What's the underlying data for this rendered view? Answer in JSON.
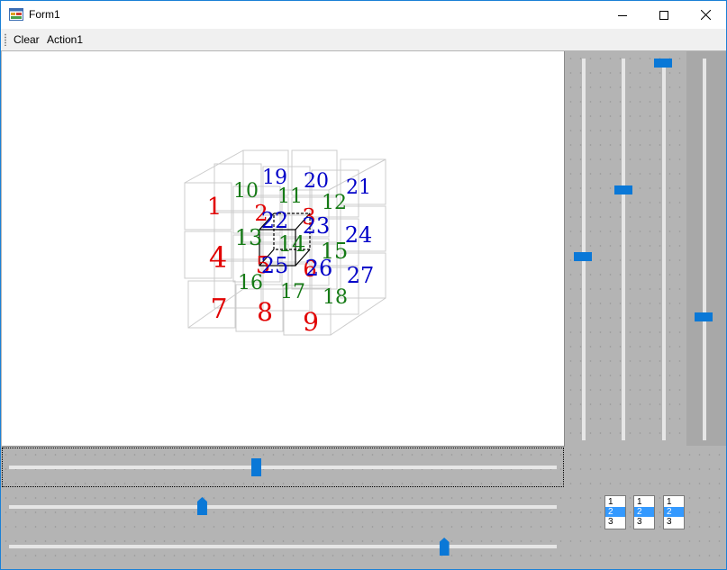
{
  "window": {
    "title": "Form1",
    "icons": {
      "app": "winforms-app-icon",
      "minimize": "minimize-icon",
      "maximize": "maximize-icon",
      "close": "close-icon"
    }
  },
  "menu": {
    "items": [
      {
        "label": "Clear"
      },
      {
        "label": "Action1"
      }
    ]
  },
  "cube": {
    "labels": [
      "1",
      "2",
      "3",
      "4",
      "5",
      "6",
      "7",
      "8",
      "9",
      "10",
      "11",
      "12",
      "13",
      "14",
      "15",
      "16",
      "17",
      "18",
      "19",
      "20",
      "21",
      "22",
      "23",
      "24",
      "25",
      "26",
      "27"
    ],
    "colors": {
      "front": "#e10000",
      "middle": "#157a15",
      "back": "#0000c8",
      "wire": "#c8c8c8",
      "selected": "#000000"
    }
  },
  "sliders": {
    "right": [
      {
        "name": "right-slider-1",
        "value_fraction": 0.52
      },
      {
        "name": "right-slider-2",
        "value_fraction": 0.34
      },
      {
        "name": "right-slider-3",
        "value_fraction": 0.0
      },
      {
        "name": "right-slider-4",
        "value_fraction": 0.68
      }
    ],
    "bottom": [
      {
        "name": "bottom-slider-1",
        "value_fraction": 0.45
      },
      {
        "name": "bottom-slider-2",
        "value_fraction": 0.35
      },
      {
        "name": "bottom-slider-3",
        "value_fraction": 0.8
      }
    ]
  },
  "listboxes": [
    {
      "items": [
        "1",
        "2",
        "3"
      ],
      "selected": "2"
    },
    {
      "items": [
        "1",
        "2",
        "3"
      ],
      "selected": "2"
    },
    {
      "items": [
        "1",
        "2",
        "3"
      ],
      "selected": "2"
    }
  ]
}
